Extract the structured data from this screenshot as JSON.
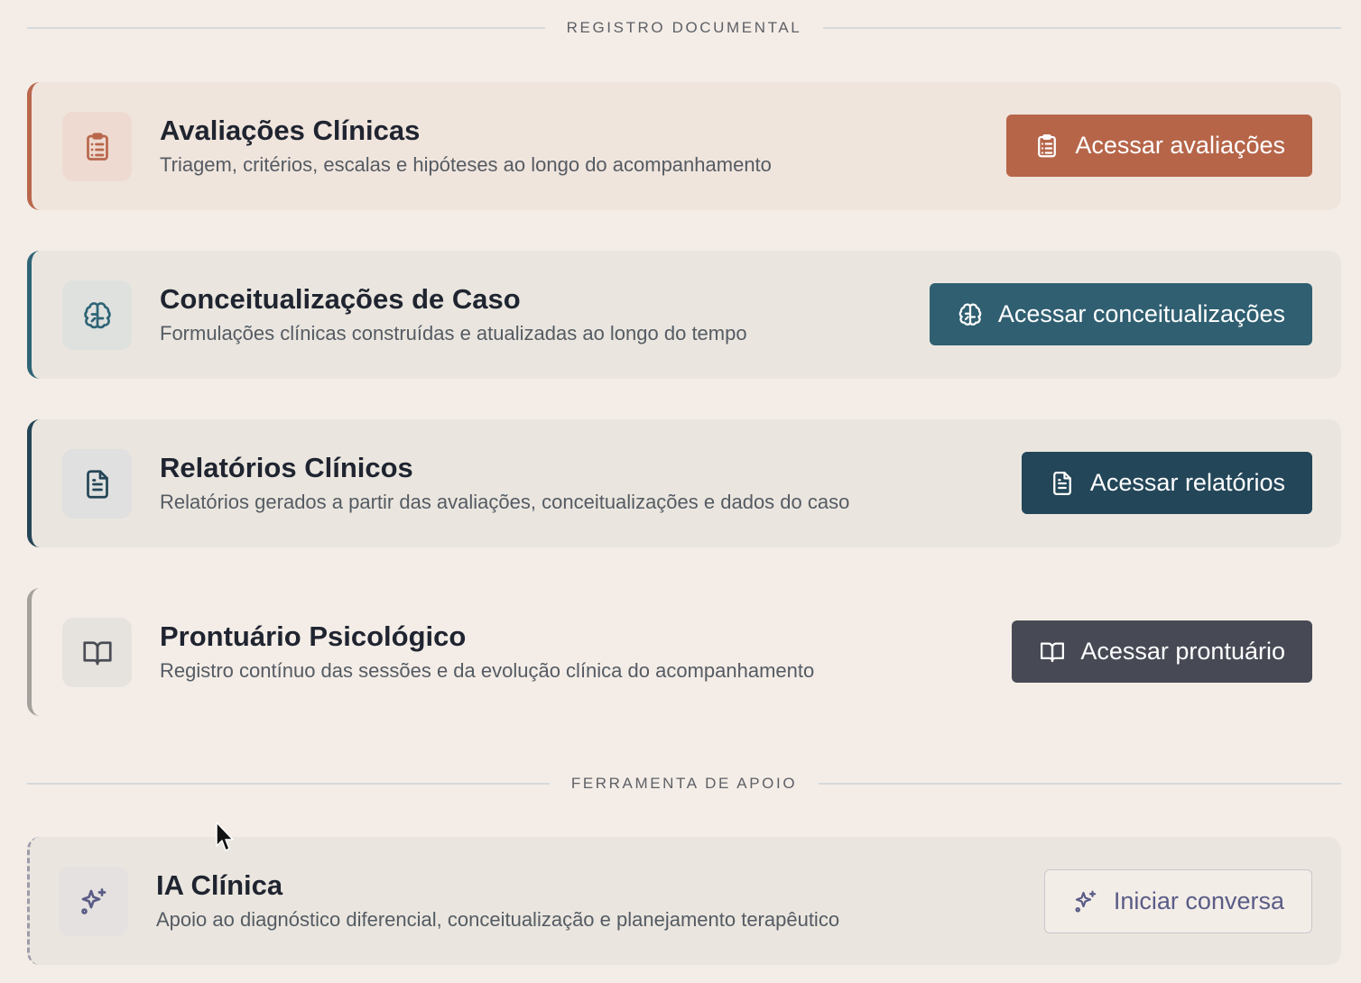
{
  "sections": {
    "documental_label": "REGISTRO DOCUMENTAL",
    "apoio_label": "FERRAMENTA DE APOIO"
  },
  "cards": [
    {
      "title": "Avaliações Clínicas",
      "description": "Triagem, critérios, escalas e hipóteses ao longo do acompanhamento",
      "button_label": "Acessar avaliações",
      "icon": "clipboard-list-icon",
      "accent_color": "#b9674c"
    },
    {
      "title": "Conceitualizações de Caso",
      "description": "Formulações clínicas construídas e atualizadas ao longo do tempo",
      "button_label": "Acessar conceitualizações",
      "icon": "brain-icon",
      "accent_color": "#2e6476"
    },
    {
      "title": "Relatórios Clínicos",
      "description": "Relatórios gerados a partir das avaliações, conceitualizações e dados do caso",
      "button_label": "Acessar relatórios",
      "icon": "file-text-icon",
      "accent_color": "#244556"
    },
    {
      "title": "Prontuário Psicológico",
      "description": "Registro contínuo das sessões e da evolução clínica do acompanhamento",
      "button_label": "Acessar prontuário",
      "icon": "book-open-icon",
      "accent_color": "#a4a09b"
    }
  ],
  "ai_card": {
    "title": "IA Clínica",
    "description": "Apoio ao diagnóstico diferencial, conceitualização e planejamento terapêutico",
    "button_label": "Iniciar conversa",
    "icon": "sparkles-icon",
    "accent_color": "#9e9aaa"
  }
}
